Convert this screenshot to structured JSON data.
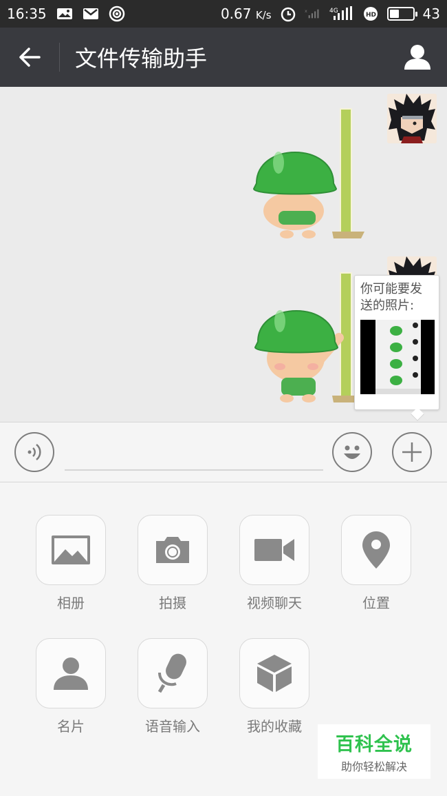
{
  "status_bar": {
    "time": "16:35",
    "speed": "0.67",
    "speed_unit": "K/s",
    "network": "4G",
    "battery": "43",
    "battery_level": 0.43
  },
  "header": {
    "title": "文件传输助手",
    "back_icon": "arrow-left-icon",
    "profile_icon": "person-icon"
  },
  "chat": {
    "messages": [
      {
        "type": "sticker",
        "from": "me"
      },
      {
        "type": "sticker",
        "from": "me"
      }
    ]
  },
  "popup": {
    "text": "你可能要发送的照片:"
  },
  "input_bar": {
    "voice_icon": "voice-icon",
    "emoji_icon": "emoji-icon",
    "plus_icon": "plus-icon",
    "value": ""
  },
  "panel": {
    "items": [
      {
        "label": "相册",
        "icon": "image-icon"
      },
      {
        "label": "拍摄",
        "icon": "camera-icon"
      },
      {
        "label": "视频聊天",
        "icon": "video-icon"
      },
      {
        "label": "位置",
        "icon": "location-pin-icon"
      },
      {
        "label": "名片",
        "icon": "person-card-icon"
      },
      {
        "label": "语音输入",
        "icon": "microphone-icon"
      },
      {
        "label": "我的收藏",
        "icon": "cube-icon"
      }
    ]
  },
  "watermark": {
    "title": "百科全说",
    "subtitle": "助你轻松解决"
  },
  "colors": {
    "header_bg": "#393a3f",
    "status_bg": "#2b2b2b",
    "chat_bg": "#ebebeb",
    "sticker_green": "#3cb043",
    "watermark_green": "#2fc24e"
  }
}
